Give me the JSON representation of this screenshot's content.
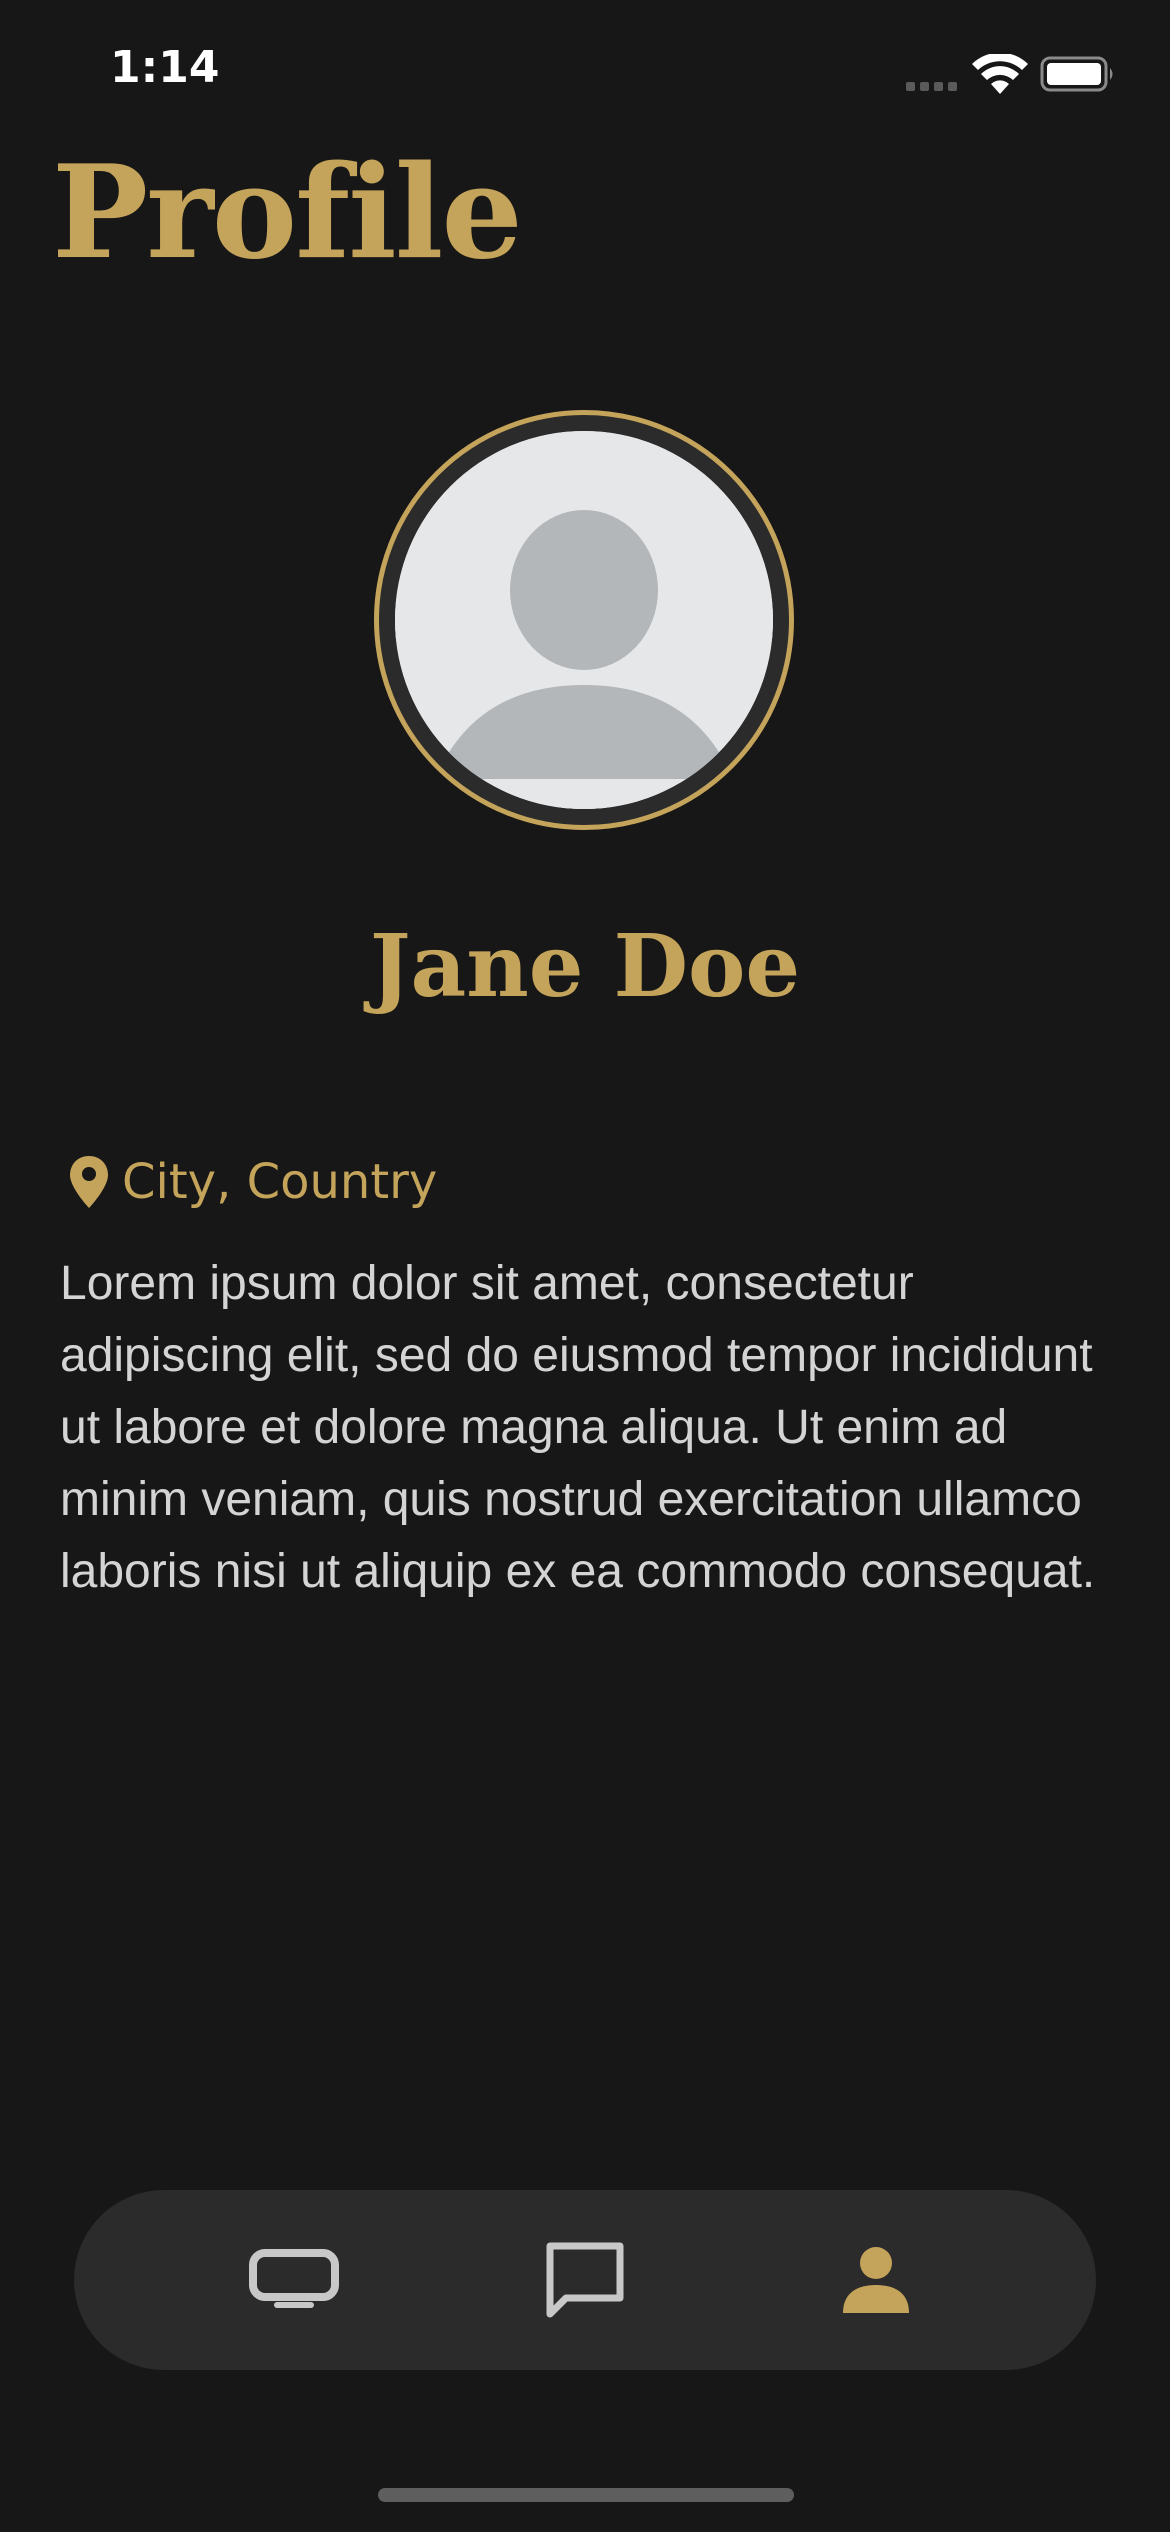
{
  "status_bar": {
    "time": "1:14"
  },
  "page": {
    "title": "Profile"
  },
  "profile": {
    "name": "Jane Doe",
    "location": "City, Country",
    "bio": "Lorem ipsum dolor sit amet, consectetur adipiscing elit, sed do eiusmod tempor incididunt ut labore et dolore magna aliqua. Ut enim ad minim veniam, quis nostrud exercitation ullamco laboris nisi ut aliquip ex ea commodo consequat.",
    "avatar_icon": "default-person-avatar"
  },
  "tab_bar": {
    "tabs": [
      {
        "icon": "tv-icon",
        "active": false
      },
      {
        "icon": "chat-bubble-icon",
        "active": false
      },
      {
        "icon": "person-icon",
        "active": true
      }
    ]
  },
  "colors": {
    "background": "#171717",
    "accent": "#c4a35a",
    "tab_bar": "#2b2b2b",
    "inactive_icon": "#c8c8c8",
    "body_text": "#d4d4d4"
  }
}
